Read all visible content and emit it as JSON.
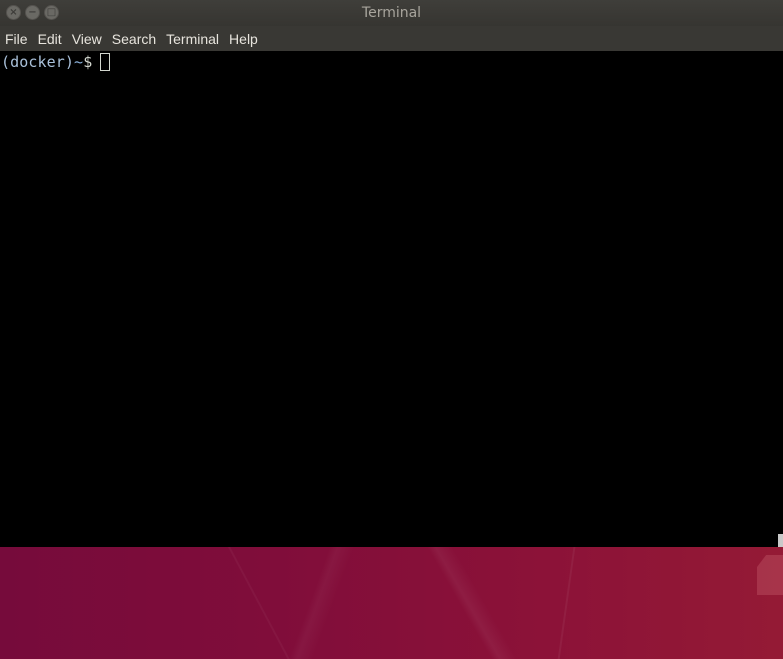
{
  "window": {
    "title": "Terminal",
    "controls": {
      "close_icon": "close-icon",
      "minimize_icon": "minimize-icon",
      "maximize_icon": "maximize-icon",
      "close_glyph": "×",
      "minimize_glyph": "−",
      "maximize_glyph": "□"
    }
  },
  "menubar": {
    "items": [
      {
        "label": "File"
      },
      {
        "label": "Edit"
      },
      {
        "label": "View"
      },
      {
        "label": "Search"
      },
      {
        "label": "Terminal"
      },
      {
        "label": "Help"
      }
    ]
  },
  "terminal": {
    "prompt_env": "(docker)",
    "prompt_path": "~",
    "prompt_symbol": "$",
    "current_input": ""
  },
  "colors": {
    "terminal_background": "#000000",
    "terminal_text": "#d3d7cf",
    "prompt_color": "#8ab1db",
    "desktop_background": "#7a0d3c",
    "titlebar_background": "#3f3e3a",
    "menubar_background": "#393834"
  }
}
